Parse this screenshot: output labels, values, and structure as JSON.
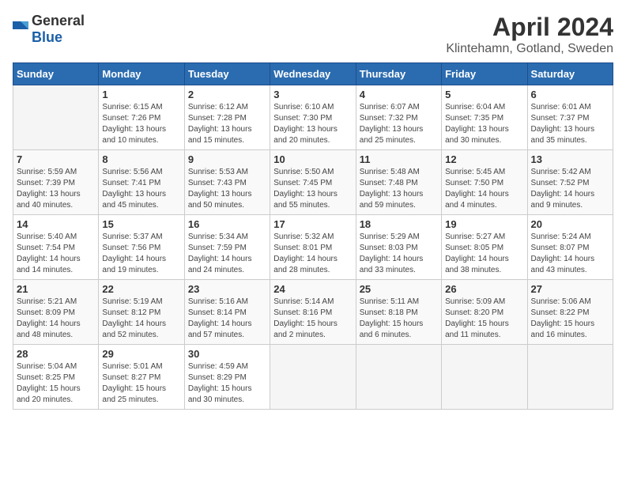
{
  "logo": {
    "text_general": "General",
    "text_blue": "Blue"
  },
  "header": {
    "month_year": "April 2024",
    "location": "Klintehamn, Gotland, Sweden"
  },
  "weekdays": [
    "Sunday",
    "Monday",
    "Tuesday",
    "Wednesday",
    "Thursday",
    "Friday",
    "Saturday"
  ],
  "weeks": [
    [
      {
        "day": "",
        "sunrise": "",
        "sunset": "",
        "daylight": "",
        "empty": true
      },
      {
        "day": "1",
        "sunrise": "Sunrise: 6:15 AM",
        "sunset": "Sunset: 7:26 PM",
        "daylight": "Daylight: 13 hours and 10 minutes."
      },
      {
        "day": "2",
        "sunrise": "Sunrise: 6:12 AM",
        "sunset": "Sunset: 7:28 PM",
        "daylight": "Daylight: 13 hours and 15 minutes."
      },
      {
        "day": "3",
        "sunrise": "Sunrise: 6:10 AM",
        "sunset": "Sunset: 7:30 PM",
        "daylight": "Daylight: 13 hours and 20 minutes."
      },
      {
        "day": "4",
        "sunrise": "Sunrise: 6:07 AM",
        "sunset": "Sunset: 7:32 PM",
        "daylight": "Daylight: 13 hours and 25 minutes."
      },
      {
        "day": "5",
        "sunrise": "Sunrise: 6:04 AM",
        "sunset": "Sunset: 7:35 PM",
        "daylight": "Daylight: 13 hours and 30 minutes."
      },
      {
        "day": "6",
        "sunrise": "Sunrise: 6:01 AM",
        "sunset": "Sunset: 7:37 PM",
        "daylight": "Daylight: 13 hours and 35 minutes."
      }
    ],
    [
      {
        "day": "7",
        "sunrise": "Sunrise: 5:59 AM",
        "sunset": "Sunset: 7:39 PM",
        "daylight": "Daylight: 13 hours and 40 minutes."
      },
      {
        "day": "8",
        "sunrise": "Sunrise: 5:56 AM",
        "sunset": "Sunset: 7:41 PM",
        "daylight": "Daylight: 13 hours and 45 minutes."
      },
      {
        "day": "9",
        "sunrise": "Sunrise: 5:53 AM",
        "sunset": "Sunset: 7:43 PM",
        "daylight": "Daylight: 13 hours and 50 minutes."
      },
      {
        "day": "10",
        "sunrise": "Sunrise: 5:50 AM",
        "sunset": "Sunset: 7:45 PM",
        "daylight": "Daylight: 13 hours and 55 minutes."
      },
      {
        "day": "11",
        "sunrise": "Sunrise: 5:48 AM",
        "sunset": "Sunset: 7:48 PM",
        "daylight": "Daylight: 13 hours and 59 minutes."
      },
      {
        "day": "12",
        "sunrise": "Sunrise: 5:45 AM",
        "sunset": "Sunset: 7:50 PM",
        "daylight": "Daylight: 14 hours and 4 minutes."
      },
      {
        "day": "13",
        "sunrise": "Sunrise: 5:42 AM",
        "sunset": "Sunset: 7:52 PM",
        "daylight": "Daylight: 14 hours and 9 minutes."
      }
    ],
    [
      {
        "day": "14",
        "sunrise": "Sunrise: 5:40 AM",
        "sunset": "Sunset: 7:54 PM",
        "daylight": "Daylight: 14 hours and 14 minutes."
      },
      {
        "day": "15",
        "sunrise": "Sunrise: 5:37 AM",
        "sunset": "Sunset: 7:56 PM",
        "daylight": "Daylight: 14 hours and 19 minutes."
      },
      {
        "day": "16",
        "sunrise": "Sunrise: 5:34 AM",
        "sunset": "Sunset: 7:59 PM",
        "daylight": "Daylight: 14 hours and 24 minutes."
      },
      {
        "day": "17",
        "sunrise": "Sunrise: 5:32 AM",
        "sunset": "Sunset: 8:01 PM",
        "daylight": "Daylight: 14 hours and 28 minutes."
      },
      {
        "day": "18",
        "sunrise": "Sunrise: 5:29 AM",
        "sunset": "Sunset: 8:03 PM",
        "daylight": "Daylight: 14 hours and 33 minutes."
      },
      {
        "day": "19",
        "sunrise": "Sunrise: 5:27 AM",
        "sunset": "Sunset: 8:05 PM",
        "daylight": "Daylight: 14 hours and 38 minutes."
      },
      {
        "day": "20",
        "sunrise": "Sunrise: 5:24 AM",
        "sunset": "Sunset: 8:07 PM",
        "daylight": "Daylight: 14 hours and 43 minutes."
      }
    ],
    [
      {
        "day": "21",
        "sunrise": "Sunrise: 5:21 AM",
        "sunset": "Sunset: 8:09 PM",
        "daylight": "Daylight: 14 hours and 48 minutes."
      },
      {
        "day": "22",
        "sunrise": "Sunrise: 5:19 AM",
        "sunset": "Sunset: 8:12 PM",
        "daylight": "Daylight: 14 hours and 52 minutes."
      },
      {
        "day": "23",
        "sunrise": "Sunrise: 5:16 AM",
        "sunset": "Sunset: 8:14 PM",
        "daylight": "Daylight: 14 hours and 57 minutes."
      },
      {
        "day": "24",
        "sunrise": "Sunrise: 5:14 AM",
        "sunset": "Sunset: 8:16 PM",
        "daylight": "Daylight: 15 hours and 2 minutes."
      },
      {
        "day": "25",
        "sunrise": "Sunrise: 5:11 AM",
        "sunset": "Sunset: 8:18 PM",
        "daylight": "Daylight: 15 hours and 6 minutes."
      },
      {
        "day": "26",
        "sunrise": "Sunrise: 5:09 AM",
        "sunset": "Sunset: 8:20 PM",
        "daylight": "Daylight: 15 hours and 11 minutes."
      },
      {
        "day": "27",
        "sunrise": "Sunrise: 5:06 AM",
        "sunset": "Sunset: 8:22 PM",
        "daylight": "Daylight: 15 hours and 16 minutes."
      }
    ],
    [
      {
        "day": "28",
        "sunrise": "Sunrise: 5:04 AM",
        "sunset": "Sunset: 8:25 PM",
        "daylight": "Daylight: 15 hours and 20 minutes."
      },
      {
        "day": "29",
        "sunrise": "Sunrise: 5:01 AM",
        "sunset": "Sunset: 8:27 PM",
        "daylight": "Daylight: 15 hours and 25 minutes."
      },
      {
        "day": "30",
        "sunrise": "Sunrise: 4:59 AM",
        "sunset": "Sunset: 8:29 PM",
        "daylight": "Daylight: 15 hours and 30 minutes."
      },
      {
        "day": "",
        "sunrise": "",
        "sunset": "",
        "daylight": "",
        "empty": true
      },
      {
        "day": "",
        "sunrise": "",
        "sunset": "",
        "daylight": "",
        "empty": true
      },
      {
        "day": "",
        "sunrise": "",
        "sunset": "",
        "daylight": "",
        "empty": true
      },
      {
        "day": "",
        "sunrise": "",
        "sunset": "",
        "daylight": "",
        "empty": true
      }
    ]
  ]
}
